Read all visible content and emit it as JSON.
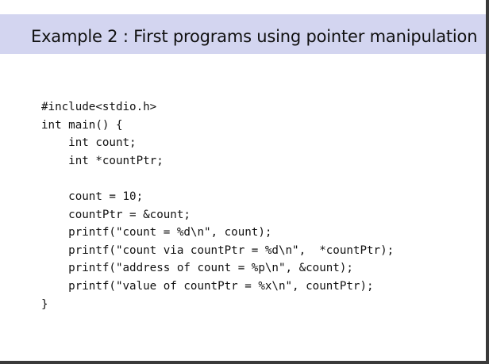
{
  "slide": {
    "title": "Example 2 : First programs using pointer manipulation"
  },
  "code": {
    "lines": [
      "#include<stdio.h>",
      "int main() {",
      "    int count;",
      "    int *countPtr;",
      "",
      "    count = 10;",
      "    countPtr = &count;",
      "    printf(\"count = %d\\n\", count);",
      "    printf(\"count via countPtr = %d\\n\",  *countPtr);",
      "    printf(\"address of count = %p\\n\", &count);",
      "    printf(\"value of countPtr = %x\\n\", countPtr);",
      "}"
    ]
  }
}
